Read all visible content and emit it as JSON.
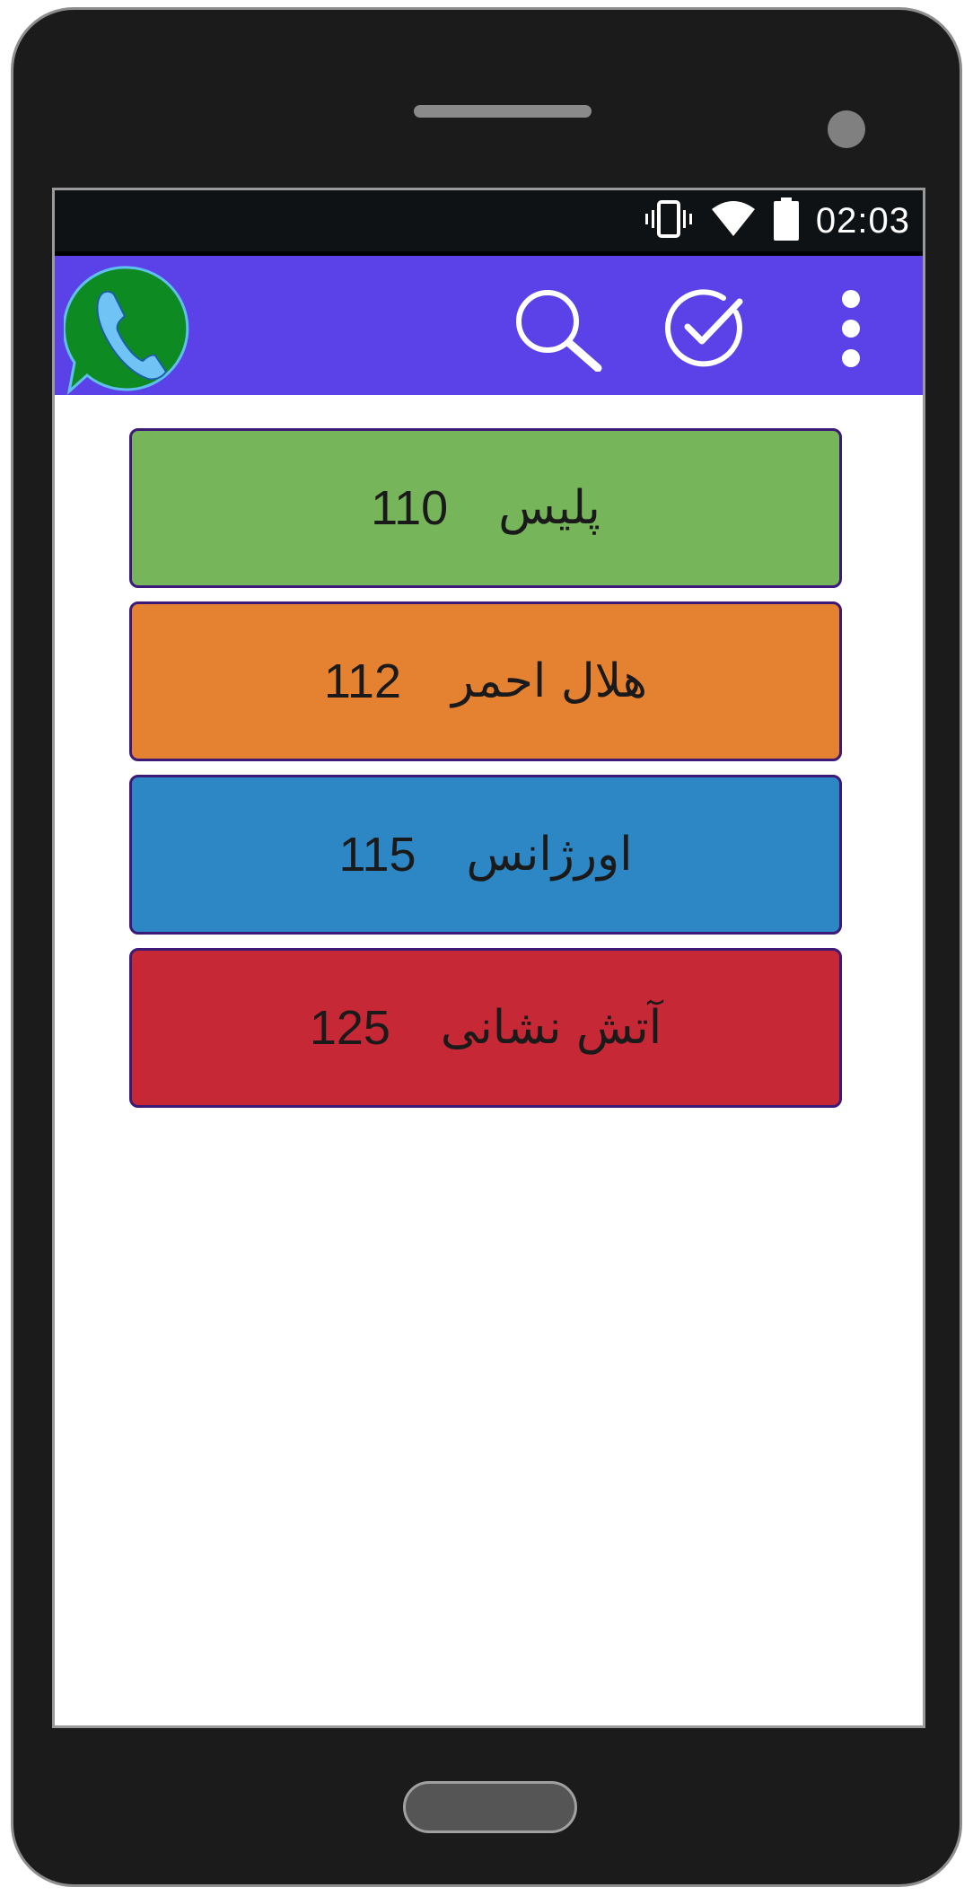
{
  "status_bar": {
    "time": "02:03",
    "icons": [
      "vibrate-icon",
      "wifi-icon",
      "battery-icon"
    ]
  },
  "app_bar": {
    "background": "#5b42e8",
    "logo": "phone-app-logo",
    "actions": [
      "search-icon",
      "check-circle-icon",
      "overflow-menu-icon"
    ]
  },
  "emergency_numbers": [
    {
      "label": "پلیس",
      "number": "110",
      "color": "#77b55a"
    },
    {
      "label": "هلال احمر",
      "number": "112",
      "color": "#e58232"
    },
    {
      "label": "اورژانس",
      "number": "115",
      "color": "#2e87c5"
    },
    {
      "label": "آتش نشانی",
      "number": "125",
      "color": "#c62835"
    }
  ]
}
